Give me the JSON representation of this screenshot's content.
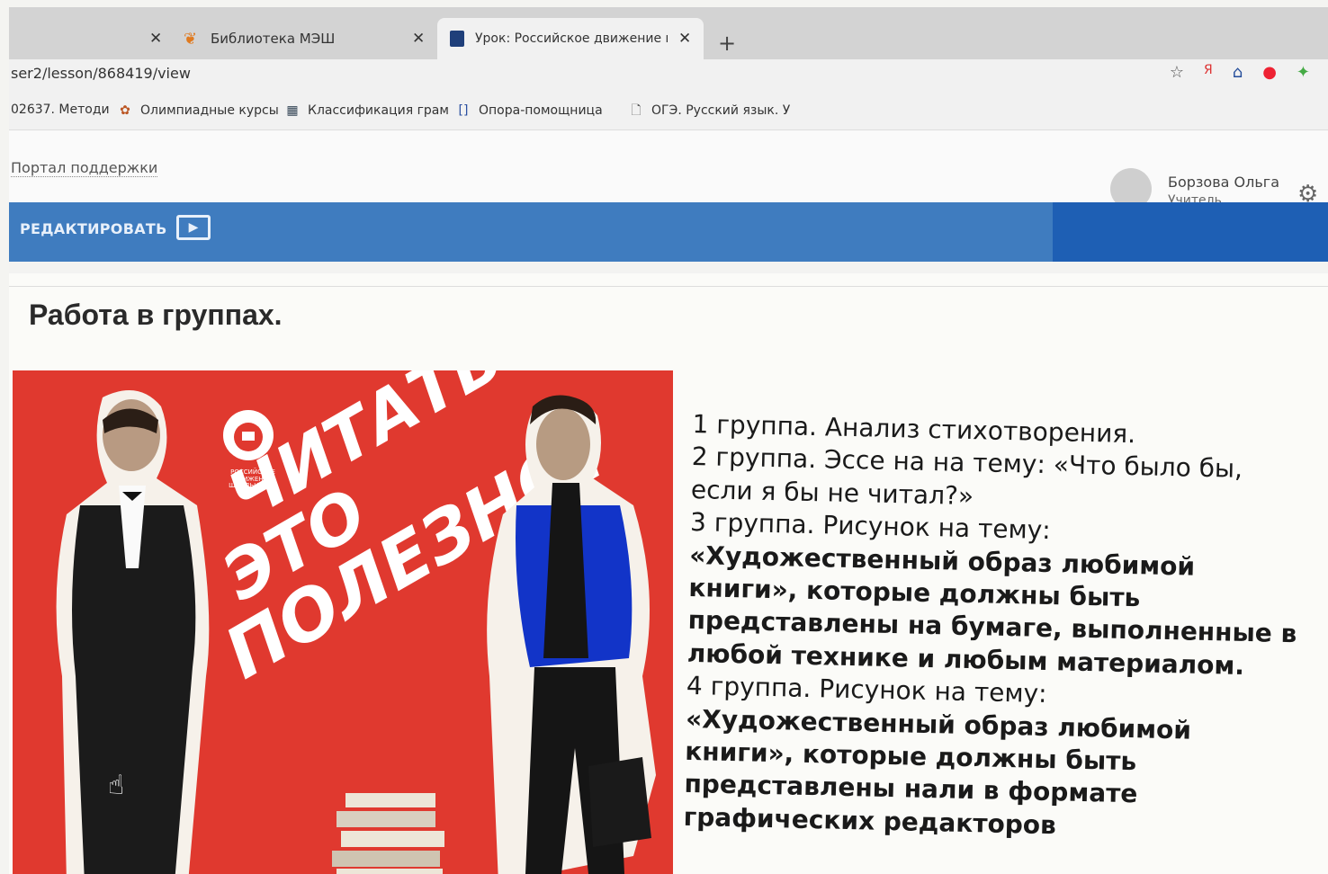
{
  "tabs": [
    {
      "title": "",
      "close": "✕"
    },
    {
      "title": "Библиотека МЭШ",
      "close": "✕"
    },
    {
      "title": "Урок: Российское движение шк",
      "close": "✕"
    }
  ],
  "new_tab": "+",
  "address": {
    "url": "ser2/lesson/868419/view"
  },
  "bookmarks": [
    {
      "label": "02637. Методи"
    },
    {
      "label": "Олимпиадные курсы"
    },
    {
      "label": "Классификация грам"
    },
    {
      "label": "Опора-помощница"
    },
    {
      "label": "ОГЭ. Русский язык. У"
    }
  ],
  "header": {
    "support_link": "Портал поддержки",
    "user_name": "Борзова Ольга",
    "user_role": "Учитель"
  },
  "toolbar": {
    "edit_label": "РЕДАКТИРОВАТЬ"
  },
  "content": {
    "heading": "Работа в группах.",
    "poster": {
      "line1": "ЧИТАТЬ -",
      "line2": "ЭТО",
      "line3": "ПОЛЕЗНО!",
      "logo_text": "РОССИЙСКОЕ ДВИЖЕНИЕ ШКОЛЬНИКОВ"
    },
    "tasks": [
      "1 группа. Анализ стихотворения.",
      "2 группа. Эссе на  на тему: «Что было бы, если я бы не читал?»",
      "3 группа. Рисунок  на тему:",
      "«Художественный образ любимой книги», которые должны быть представлены на бумаге, выполненные в любой технике и любым материалом.",
      "4 группа. Рисунок  на тему:",
      "«Художественный образ любимой книги», которые должны быть представлены нали в формате графических редакторов"
    ]
  },
  "colors": {
    "toolbar_blue": "#3f7cbf",
    "toolbar_dark_blue": "#1e5fb4",
    "poster_red": "#e0392f"
  }
}
